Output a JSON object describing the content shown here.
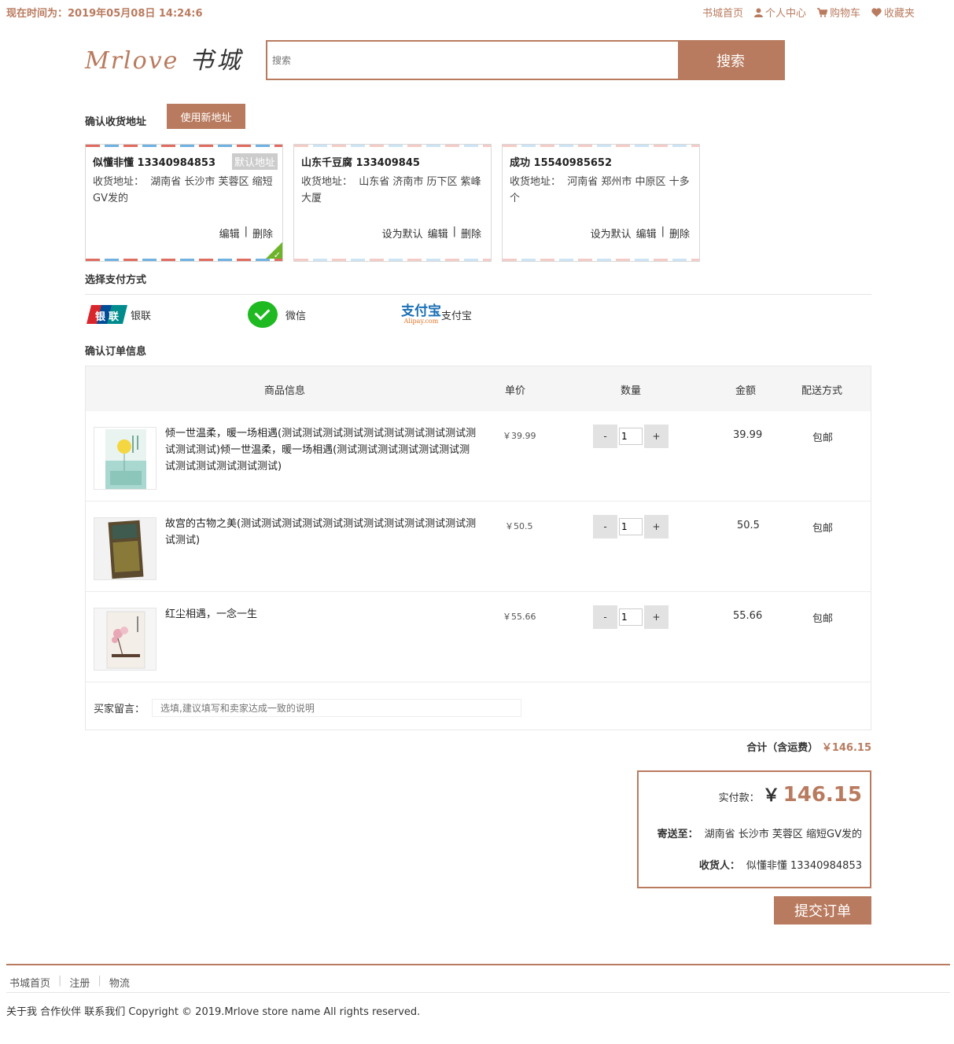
{
  "top": {
    "clock_label": "现在时间为：2019年05月08日 14:24:6",
    "nav": [
      "书城首页",
      "个人中心",
      "购物车",
      "收藏夹"
    ]
  },
  "header": {
    "logo_text": "Mrlove",
    "logo_cn": "书城",
    "search_placeholder": "搜索",
    "search_button": "搜索"
  },
  "address": {
    "title": "确认收货地址",
    "new_button": "使用新地址",
    "default_tag": "默认地址",
    "label": "收货地址：",
    "ops": {
      "set_default": "设为默认",
      "edit": "编辑",
      "sep": "|",
      "delete": "删除"
    },
    "cards": [
      {
        "name": "似懂非懂 13340984853",
        "addr": "湖南省 长沙市 芙蓉区 缩短GV发的",
        "default": true
      },
      {
        "name": "山东千豆腐 133409845",
        "addr": "山东省 济南市 历下区 紫峰大厦",
        "default": false
      },
      {
        "name": "成功 15540985652",
        "addr": "河南省 郑州市 中原区 十多个",
        "default": false
      }
    ]
  },
  "payment": {
    "title": "选择支付方式",
    "methods": [
      "银联",
      "微信",
      "支付宝"
    ],
    "unionpay_logo": [
      "银",
      "联"
    ],
    "alipay_logo": "支付宝",
    "alipay_logo_sub": "Alipay.com"
  },
  "order": {
    "title": "确认订单信息",
    "headers": [
      "商品信息",
      "单价",
      "数量",
      "金额",
      "配送方式"
    ],
    "items": [
      {
        "title": "倾一世温柔，暖一场相遇(测试测试测试测试测试测试测试测试测试测试测试测试)倾一世温柔，暖一场相遇(测试测试测试测试测试测试测试测试测试测试测试测试)",
        "price": "￥39.99",
        "qty": "1",
        "amount": "39.99",
        "ship": "包邮"
      },
      {
        "title": "故宫的古物之美(测试测试测试测试测试测试测试测试测试测试测试测试测试)",
        "price": "￥50.5",
        "qty": "1",
        "amount": "50.5",
        "ship": "包邮"
      },
      {
        "title": "红尘相遇，一念一生",
        "price": "￥55.66",
        "qty": "1",
        "amount": "55.66",
        "ship": "包邮"
      }
    ],
    "qty_minus": "-",
    "qty_plus": "+",
    "message_label": "买家留言：",
    "message_placeholder": "选填,建议填写和卖家达成一致的说明"
  },
  "summary": {
    "total_label": "合计（含运费）",
    "total_currency": "￥",
    "total_amount": "146.15",
    "real_label": "实付款：",
    "real_currency": "￥",
    "real_amount": "146.15",
    "ship_to_label": "寄送至：",
    "ship_to": "湖南省 长沙市 芙蓉区 缩短GV发的",
    "receiver_label": "收货人：",
    "receiver": "似懂非懂 13340984853",
    "submit": "提交订单"
  },
  "footer": {
    "nav": [
      "书城首页",
      "注册",
      "物流"
    ],
    "sep": "|",
    "copyright": "关于我 合作伙伴 联系我们 Copyright © 2019.Mrlove store name All rights reserved."
  },
  "colors": {
    "accent": "#b97b5f",
    "check_green": "#6eb42b",
    "wechat_green": "#1fb922"
  }
}
